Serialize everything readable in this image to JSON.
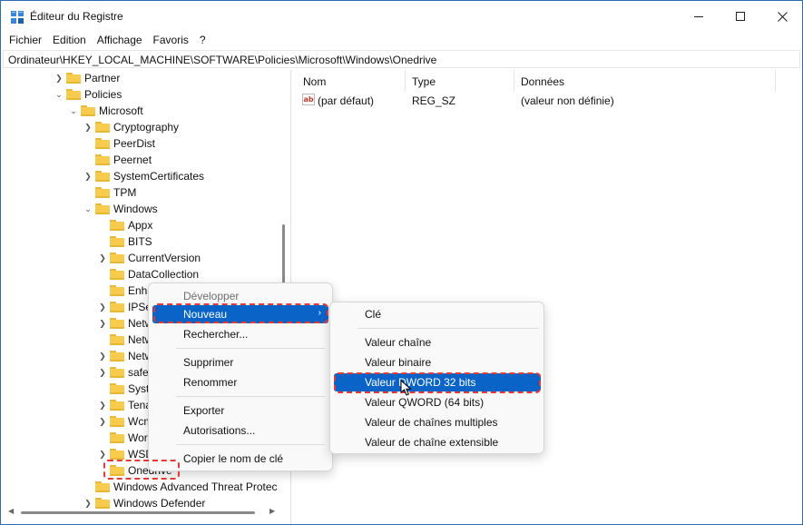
{
  "window": {
    "title": "Éditeur du Registre",
    "icon": "registry-icon",
    "accent": "#0a64c8"
  },
  "menubar": {
    "items": [
      "Fichier",
      "Edition",
      "Affichage",
      "Favoris",
      "?"
    ]
  },
  "address": {
    "path": "Ordinateur\\HKEY_LOCAL_MACHINE\\SOFTWARE\\Policies\\Microsoft\\Windows\\Onedrive"
  },
  "tree": {
    "items": [
      {
        "label": "Partner",
        "expander": "collapsed"
      },
      {
        "label": "Policies",
        "expander": "expanded"
      },
      {
        "label": "Microsoft",
        "expander": "expanded"
      },
      {
        "label": "Cryptography",
        "expander": "collapsed"
      },
      {
        "label": "PeerDist",
        "expander": "none"
      },
      {
        "label": "Peernet",
        "expander": "none"
      },
      {
        "label": "SystemCertificates",
        "expander": "collapsed"
      },
      {
        "label": "TPM",
        "expander": "none"
      },
      {
        "label": "Windows",
        "expander": "expanded"
      },
      {
        "label": "Appx",
        "expander": "none"
      },
      {
        "label": "BITS",
        "expander": "none"
      },
      {
        "label": "CurrentVersion",
        "expander": "collapsed"
      },
      {
        "label": "DataCollection",
        "expander": "none"
      },
      {
        "label": "Enha",
        "expander": "none"
      },
      {
        "label": "IPSe",
        "expander": "collapsed"
      },
      {
        "label": "Netw",
        "expander": "collapsed"
      },
      {
        "label": "Netw",
        "expander": "none"
      },
      {
        "label": "Netw",
        "expander": "collapsed"
      },
      {
        "label": "safe",
        "expander": "collapsed"
      },
      {
        "label": "Syst",
        "expander": "none"
      },
      {
        "label": "Tena",
        "expander": "collapsed"
      },
      {
        "label": "Wcm",
        "expander": "collapsed"
      },
      {
        "label": "Wor",
        "expander": "none"
      },
      {
        "label": "WSD",
        "expander": "collapsed"
      },
      {
        "label": "Onedrive",
        "expander": "none"
      },
      {
        "label": "Windows Advanced Threat Protec",
        "expander": "none"
      },
      {
        "label": "Windows Defender",
        "expander": "collapsed"
      }
    ]
  },
  "list": {
    "columns": [
      "Nom",
      "Type",
      "Données"
    ],
    "rows": [
      {
        "name": "(par défaut)",
        "type": "REG_SZ",
        "data": "(valeur non définie)"
      }
    ]
  },
  "context_menu": {
    "items": [
      "Développer",
      "Nouveau",
      "Rechercher...",
      "Supprimer",
      "Renommer",
      "Exporter",
      "Autorisations...",
      "Copier le nom de clé"
    ],
    "submenu_arrow": "›"
  },
  "submenu": {
    "items": [
      "Clé",
      "Valeur chaîne",
      "Valeur binaire",
      "Valeur DWORD 32 bits",
      "Valeur QWORD (64 bits)",
      "Valeur de chaînes multiples",
      "Valeur de chaîne extensible"
    ]
  },
  "colors": {
    "selection": "#0a64c8",
    "highlight_dash": "#e53935",
    "folder": "#f7cb4d"
  }
}
